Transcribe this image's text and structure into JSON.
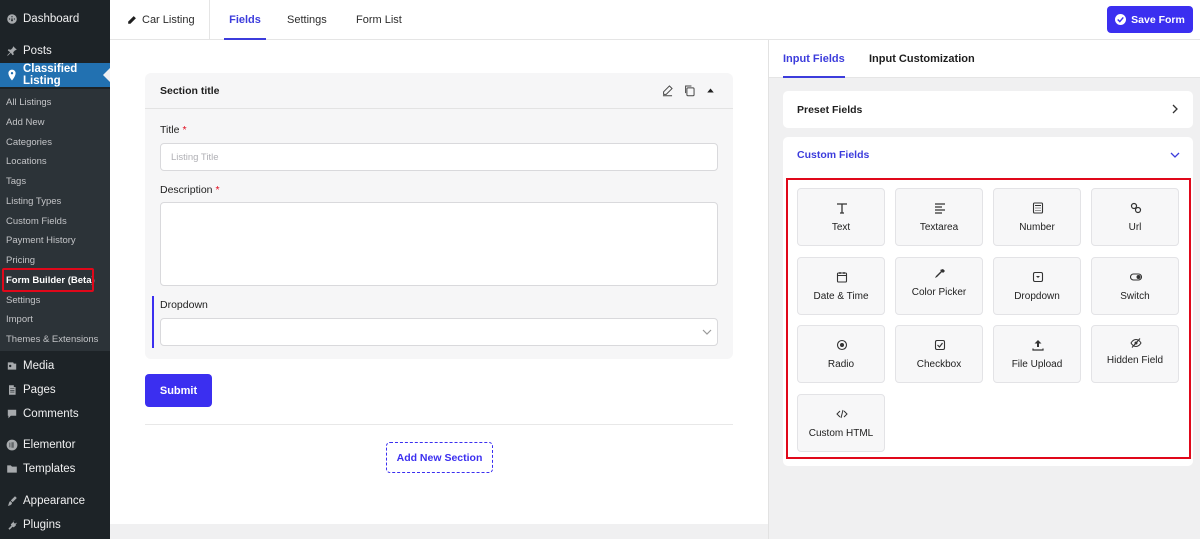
{
  "sidebar": {
    "top": [
      {
        "label": "Dashboard",
        "icon": "dashboard-icon"
      },
      {
        "label": "Posts",
        "icon": "pin-icon"
      },
      {
        "label": "Classified Listing",
        "icon": "location-pin-icon"
      }
    ],
    "sub": [
      "All Listings",
      "Add New",
      "Categories",
      "Locations",
      "Tags",
      "Listing Types",
      "Custom Fields",
      "Payment History",
      "Pricing",
      "Form Builder (Beta)",
      "Settings",
      "Import",
      "Themes & Extensions"
    ],
    "bottom": [
      {
        "label": "Media",
        "icon": "media-icon"
      },
      {
        "label": "Pages",
        "icon": "pages-icon"
      },
      {
        "label": "Comments",
        "icon": "comment-icon"
      },
      {
        "label": "Elementor",
        "icon": "elementor-icon"
      },
      {
        "label": "Templates",
        "icon": "folder-icon"
      },
      {
        "label": "Appearance",
        "icon": "brush-icon"
      },
      {
        "label": "Plugins",
        "icon": "plug-icon"
      }
    ]
  },
  "topbar": {
    "form_name": "Car Listing",
    "tabs": [
      "Fields",
      "Settings",
      "Form List"
    ],
    "save_label": "Save Form"
  },
  "section": {
    "title": "Section title",
    "fields": {
      "title_label": "Title",
      "title_placeholder": "Listing Title",
      "description_label": "Description",
      "dropdown_label": "Dropdown",
      "required_mark": "*"
    },
    "submit_label": "Submit",
    "add_section_label": "Add New Section"
  },
  "panel": {
    "tabs": [
      "Input Fields",
      "Input Customization"
    ],
    "preset_title": "Preset Fields",
    "custom_title": "Custom Fields",
    "fields": [
      {
        "label": "Text",
        "icon": "text-icon"
      },
      {
        "label": "Textarea",
        "icon": "textarea-icon"
      },
      {
        "label": "Number",
        "icon": "calculator-icon"
      },
      {
        "label": "Url",
        "icon": "link-icon"
      },
      {
        "label": "Date & Time",
        "icon": "calendar-icon"
      },
      {
        "label": "Color Picker",
        "icon": "eyedropper-icon"
      },
      {
        "label": "Dropdown",
        "icon": "dropdown-icon"
      },
      {
        "label": "Switch",
        "icon": "toggle-icon"
      },
      {
        "label": "Radio",
        "icon": "radio-icon"
      },
      {
        "label": "Checkbox",
        "icon": "checkbox-icon"
      },
      {
        "label": "File Upload",
        "icon": "upload-icon"
      },
      {
        "label": "Hidden Field",
        "icon": "eye-off-icon"
      },
      {
        "label": "Custom HTML",
        "icon": "code-icon"
      }
    ]
  },
  "colors": {
    "accent": "#3b2ff0",
    "sidebar_bg": "#1d2327",
    "highlight": "#e0081a",
    "wp_blue": "#2271b1"
  }
}
